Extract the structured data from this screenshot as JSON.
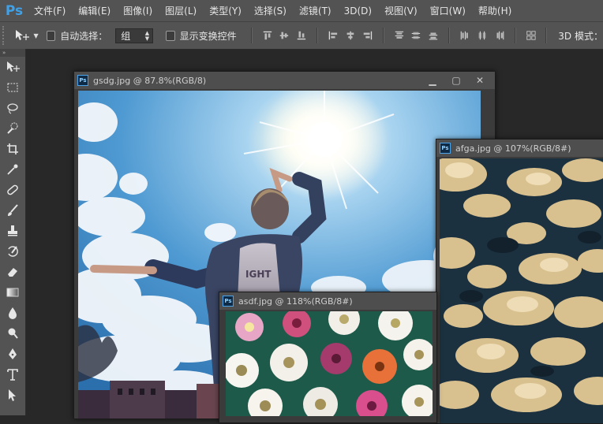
{
  "app": {
    "logo": "Ps"
  },
  "menu": [
    "文件(F)",
    "编辑(E)",
    "图像(I)",
    "图层(L)",
    "类型(Y)",
    "选择(S)",
    "滤镜(T)",
    "3D(D)",
    "视图(V)",
    "窗口(W)",
    "帮助(H)"
  ],
  "options": {
    "auto_select_label": "自动选择：",
    "auto_select_value": "组",
    "transform_label": "显示变换控件",
    "mode_3d_label": "3D 模式："
  },
  "documents": [
    {
      "title": "gsdg.jpg @ 87.8%(RGB/8)"
    },
    {
      "title": "afga.jpg @ 107%(RGB/8#)"
    },
    {
      "title": "asdf.jpg @ 118%(RGB/8#)"
    }
  ],
  "photo_text": {
    "shirt": "IGHT"
  },
  "colors": {
    "chrome": "#535353",
    "workspace": "#282828",
    "ps_blue": "#3fa1e8"
  }
}
